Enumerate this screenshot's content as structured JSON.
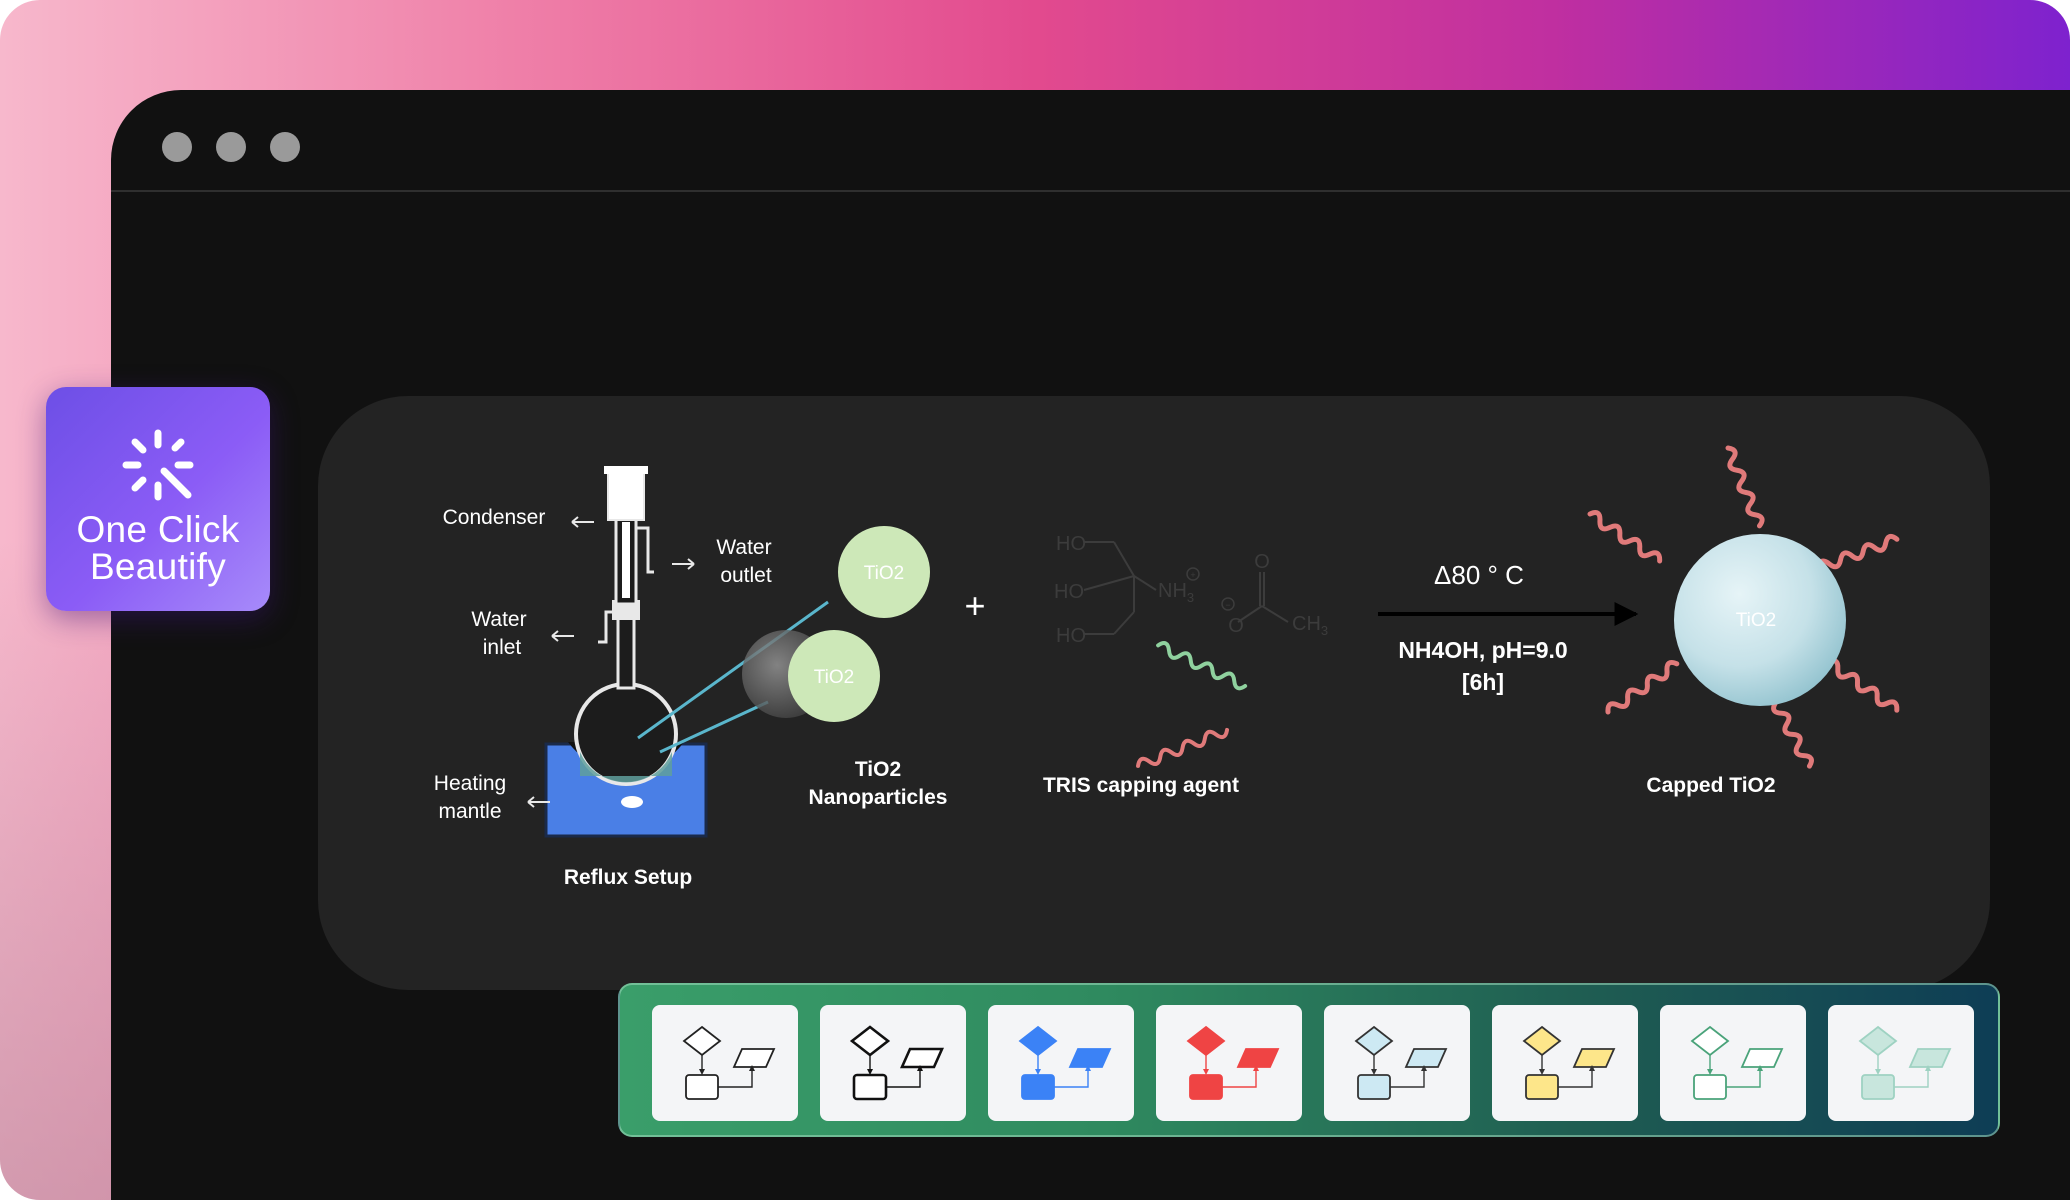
{
  "badge": {
    "line1": "One Click",
    "line2": "Beautify",
    "icon": "sparkle-wand-icon"
  },
  "window": {
    "controls": [
      "window-dot-1",
      "window-dot-2",
      "window-dot-3"
    ]
  },
  "diagram": {
    "reflux": {
      "condenser": "Condenser",
      "water_outlet_1": "Water",
      "water_outlet_2": "outlet",
      "water_inlet_1": "Water",
      "water_inlet_2": "inlet",
      "heating_1": "Heating",
      "heating_2": "mantle",
      "caption": "Reflux Setup"
    },
    "nanoparticles": {
      "particle_a": "TiO2",
      "particle_b": "TiO2",
      "caption_1": "TiO2",
      "caption_2": "Nanoparticles"
    },
    "plus": "+",
    "tris": {
      "ho_1": "HO",
      "ho_2": "HO",
      "ho_3": "HO",
      "nh3": "NH",
      "nh3_sub": "3",
      "charge_pos": "+",
      "charge_neg": "−",
      "o_top": "O",
      "o_left": "O",
      "ch3": "CH",
      "ch3_sub": "3",
      "caption": "TRIS capping agent"
    },
    "reaction": {
      "condition_1": "Δ80 °  C",
      "condition_2": "NH4OH, pH=9.0",
      "condition_3": "[6h]"
    },
    "product": {
      "particle": "TiO2",
      "caption": "Capped TiO2"
    },
    "colors": {
      "particle_green": "#cde8b8",
      "arm_pink": "#e07a7a",
      "arm_green": "#8fd19e",
      "mantle_blue": "#4a7fe6",
      "product_sphere": "#c9e3ea"
    }
  },
  "palette": {
    "styles": [
      {
        "name": "style-outline-thin",
        "stroke": "#222222",
        "fill": "#ffffff"
      },
      {
        "name": "style-outline-bold",
        "stroke": "#111111",
        "fill": "#ffffff"
      },
      {
        "name": "style-blue",
        "stroke": "#3b82f6",
        "fill": "#3b82f6"
      },
      {
        "name": "style-red",
        "stroke": "#ef4444",
        "fill": "#ef4444"
      },
      {
        "name": "style-light-blue",
        "stroke": "#333333",
        "fill": "#cde9f3"
      },
      {
        "name": "style-yellow",
        "stroke": "#333333",
        "fill": "#fde68a"
      },
      {
        "name": "style-green-outline",
        "stroke": "#4aa37a",
        "fill": "#ffffff"
      },
      {
        "name": "style-mint",
        "stroke": "#9ed2c2",
        "fill": "#c8e6dd"
      }
    ]
  }
}
